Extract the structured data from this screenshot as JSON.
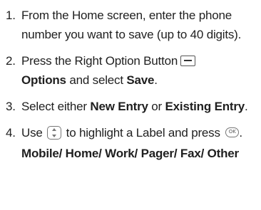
{
  "steps": [
    {
      "number": "1.",
      "text": "From the Home screen, enter the phone number you want to save (up to 40 digits)."
    },
    {
      "number": "2.",
      "text_before": "Press the Right Option Button",
      "bold1": "Options",
      "text_mid": " and select ",
      "bold2": "Save",
      "text_end": ".",
      "icon": "right-softkey-icon"
    },
    {
      "number": "3.",
      "text_before": "Select either ",
      "bold1": "New Entry",
      "text_mid": " or ",
      "bold2": "Existing Entry",
      "text_end": "."
    },
    {
      "number": "4.",
      "text_before": "Use ",
      "icon1": "navigation-key-icon",
      "text_mid": " to highlight a Label and press ",
      "icon2": "ok-key-icon",
      "icon2_label": "OK",
      "text_end": ".",
      "labels_line": "Mobile/ Home/ Work/ Pager/ Fax/ Other"
    }
  ]
}
